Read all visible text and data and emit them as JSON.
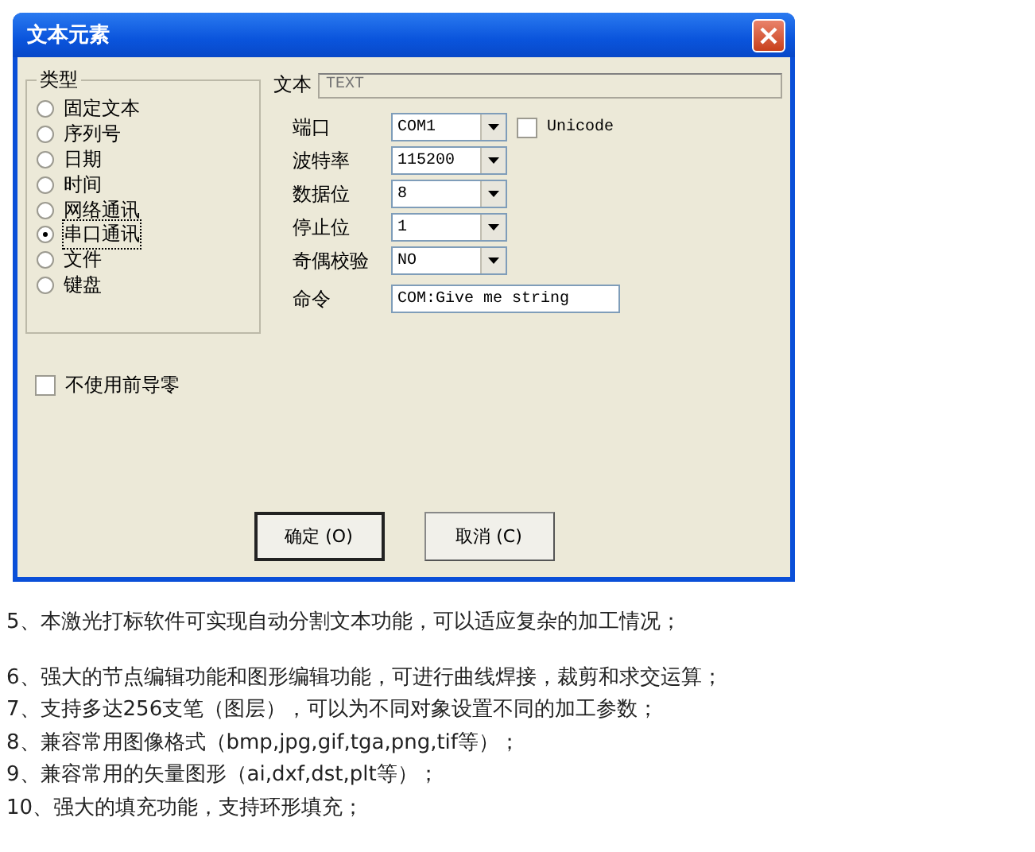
{
  "window": {
    "title": "文本元素"
  },
  "type_group": {
    "title": "类型",
    "options": [
      {
        "label": "固定文本",
        "selected": false
      },
      {
        "label": "序列号",
        "selected": false
      },
      {
        "label": "日期",
        "selected": false
      },
      {
        "label": "时间",
        "selected": false
      },
      {
        "label": "网络通讯",
        "selected": false
      },
      {
        "label": "串口通讯",
        "selected": true
      },
      {
        "label": "文件",
        "selected": false
      },
      {
        "label": "键盘",
        "selected": false
      }
    ]
  },
  "text_field": {
    "label": "文本",
    "placeholder": "TEXT",
    "disabled": true
  },
  "settings": [
    {
      "kind": "combo",
      "label": "端口",
      "value": "COM1"
    },
    {
      "kind": "combo",
      "label": "波特率",
      "value": "115200"
    },
    {
      "kind": "combo",
      "label": "数据位",
      "value": "8"
    },
    {
      "kind": "combo",
      "label": "停止位",
      "value": "1"
    },
    {
      "kind": "combo",
      "label": "奇偶校验",
      "value": "NO"
    },
    {
      "kind": "input",
      "label": "命令",
      "value": "COM:Give me string"
    }
  ],
  "unicode_checkbox": {
    "label": "Unicode",
    "checked": false
  },
  "leading_zero_checkbox": {
    "label": "不使用前导零",
    "checked": false
  },
  "buttons": [
    "确定 (O)",
    "取消 (C)"
  ],
  "features": [
    "5、本激光打标软件可实现自动分割文本功能，可以适应复杂的加工情况；",
    "6、强大的节点编辑功能和图形编辑功能，可进行曲线焊接，裁剪和求交运算；",
    "7、支持多达256支笔（图层），可以为不同对象设置不同的加工参数；",
    "8、兼容常用图像格式（bmp,jpg,gif,tga,png,tif等）；",
    "9、兼容常用的矢量图形（ai,dxf,dst,plt等）；",
    "10、强大的填充功能，支持环形填充；"
  ]
}
